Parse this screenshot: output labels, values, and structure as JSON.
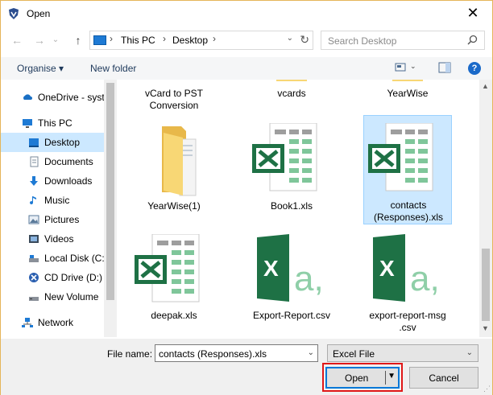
{
  "window": {
    "title": "Open",
    "close_glyph": "✕"
  },
  "nav": {
    "back_glyph": "←",
    "forward_glyph": "→",
    "recent_glyph": "⌄",
    "up_glyph": "↑",
    "path": [
      "This PC",
      "Desktop"
    ],
    "chevron": "›",
    "dropdown_glyph": "⌄",
    "refresh_glyph": "↻",
    "search_placeholder": "Search Desktop"
  },
  "toolbar": {
    "organise_label": "Organise ▾",
    "new_folder_label": "New folder",
    "help_glyph": "?"
  },
  "sidebar": {
    "items": [
      {
        "label": "OneDrive - syst",
        "icon": "cloud-icon"
      },
      {
        "label": "This PC",
        "icon": "computer-icon"
      },
      {
        "label": "Desktop",
        "icon": "desktop-icon",
        "selected": true
      },
      {
        "label": "Documents",
        "icon": "documents-icon"
      },
      {
        "label": "Downloads",
        "icon": "downloads-icon"
      },
      {
        "label": "Music",
        "icon": "music-icon"
      },
      {
        "label": "Pictures",
        "icon": "pictures-icon"
      },
      {
        "label": "Videos",
        "icon": "videos-icon"
      },
      {
        "label": "Local Disk (C:",
        "icon": "drive-icon"
      },
      {
        "label": "CD Drive (D:)",
        "icon": "cd-drive-icon"
      },
      {
        "label": "New Volume",
        "icon": "drive-icon"
      },
      {
        "label": "Network",
        "icon": "network-icon"
      }
    ]
  },
  "files": [
    {
      "name": "vCard to PST Conversion",
      "kind": "folder"
    },
    {
      "name": "vcards",
      "kind": "folder"
    },
    {
      "name": "YearWise",
      "kind": "folder"
    },
    {
      "name": "YearWise(1)",
      "kind": "folder"
    },
    {
      "name": "Book1.xls",
      "kind": "excel"
    },
    {
      "name": "contacts (Responses).xls",
      "kind": "excel",
      "selected": true
    },
    {
      "name": "deepak.xls",
      "kind": "excel"
    },
    {
      "name": "Export-Report.csv",
      "kind": "csv"
    },
    {
      "name": "export-report-msg .csv",
      "kind": "csv"
    }
  ],
  "scroll": {
    "up_glyph": "▲",
    "down_glyph": "▼"
  },
  "bottom": {
    "file_name_label": "File name:",
    "file_name_value": "contacts (Responses).xls",
    "dropdown_glyph": "⌄",
    "file_type_value": "Excel File",
    "open_label": "Open",
    "open_dropdown_glyph": "▼",
    "cancel_label": "Cancel",
    "grip_glyph": "⋰"
  },
  "colors": {
    "excel_green": "#1e7145",
    "selection": "#cce8ff",
    "highlight_box": "#e01818",
    "folder_yellow": "#f8d775"
  }
}
